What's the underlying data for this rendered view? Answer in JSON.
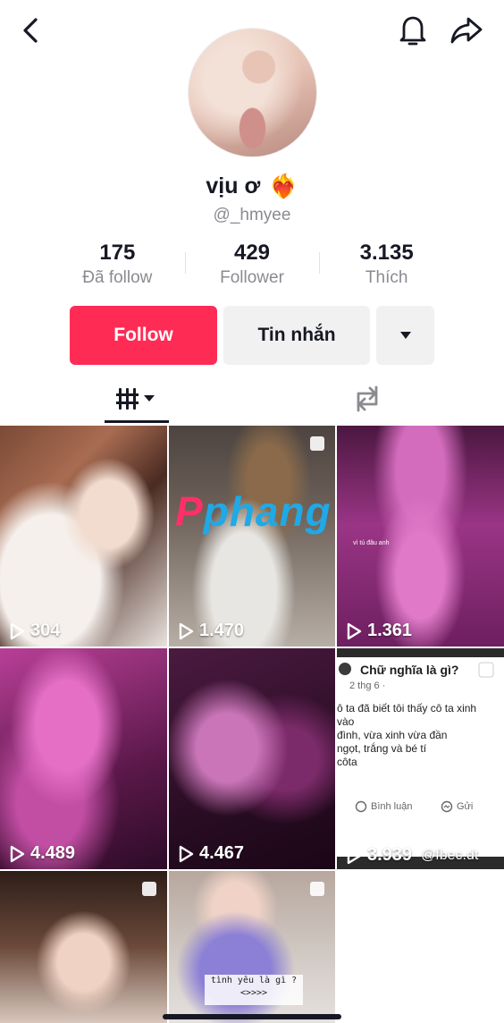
{
  "profile": {
    "display_name": "vịu ơ",
    "display_emoji": "❤️‍🔥",
    "handle": "@_hmyee",
    "stats": [
      {
        "value": "175",
        "label": "Đã follow"
      },
      {
        "value": "429",
        "label": "Follower"
      },
      {
        "value": "3.135",
        "label": "Thích"
      }
    ]
  },
  "actions": {
    "follow_label": "Follow",
    "message_label": "Tin nhắn"
  },
  "icons": {
    "back": "back-arrow-icon",
    "bell": "bell-icon",
    "share": "share-icon",
    "grid": "video-grid-icon",
    "repost": "repost-icon",
    "play": "play-icon",
    "multi": "multi-photo-icon",
    "dropdown": "caret-down-icon"
  },
  "colors": {
    "accent": "#fe2c55",
    "secondary_button": "#f1f1f2",
    "muted_text": "#8a8b91"
  },
  "videos": [
    {
      "views": "304"
    },
    {
      "views": "1.470"
    },
    {
      "views": "1.361",
      "overlay_text": "vì tú đâu anh"
    },
    {
      "views": "4.489"
    },
    {
      "views": "4.467"
    },
    {
      "views": "3.939",
      "card": {
        "title": "Chữ nghĩa là gì?",
        "meta": "2 thg 6 ·",
        "lines": [
          "ô ta đã biết tôi thấy cô ta xinh",
          "vào",
          "",
          "đình, vừa xinh vừa đần",
          "ngọt, trắng và bé tí",
          "côta"
        ],
        "comment_label": "Bình luận",
        "send_label": "Gửi"
      },
      "watermark_text": "@fbec.dt"
    },
    {},
    {
      "caption": "tình yêu là gì ?",
      "caption_sub": "<>>>>"
    }
  ],
  "watermark": {
    "first": "P",
    "rest": "phang"
  }
}
